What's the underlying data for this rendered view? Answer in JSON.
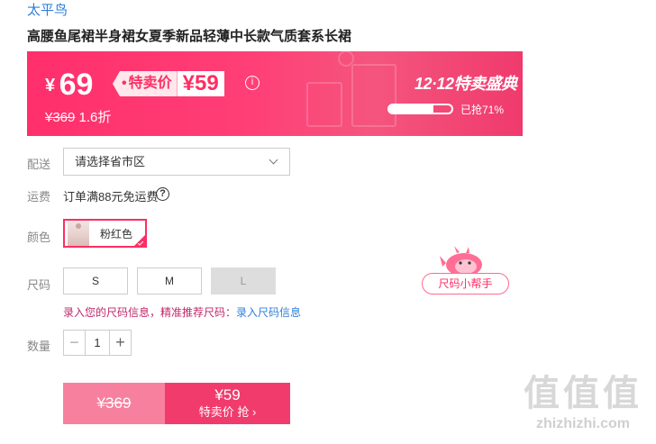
{
  "brand": "太平鸟",
  "title": "高腰鱼尾裙半身裙女夏季新品轻薄中长款气质套系长裙",
  "promo": {
    "currency": "¥",
    "price": "69",
    "tag_label": "特卖价",
    "tag_price": "¥59",
    "original_price": "¥369",
    "discount": "1.6折",
    "event": "12·12特卖盛典",
    "sold_progress": 0.71,
    "sold_text": "已抢71%",
    "icon": "info-icon"
  },
  "delivery": {
    "label": "配送",
    "placeholder": "请选择省市区"
  },
  "shipping": {
    "label": "运费",
    "text": "订单满88元免运费",
    "icon": "help-icon"
  },
  "color": {
    "label": "颜色",
    "option": "粉红色",
    "selected": true
  },
  "size": {
    "label": "尺码",
    "options": [
      {
        "label": "S",
        "available": true
      },
      {
        "label": "M",
        "available": true
      },
      {
        "label": "L",
        "available": false
      }
    ],
    "tip": "录入您的尺码信息，精准推荐尺码：",
    "tip_link": "录入尺码信息",
    "helper": "尺码小帮手"
  },
  "quantity": {
    "label": "数量",
    "value": "1"
  },
  "buy": {
    "original": "¥369",
    "sale_price": "¥59",
    "sale_action": "特卖价 抢 ›"
  },
  "watermark": {
    "big": "值值值",
    "small": "zhizhizhi.com"
  },
  "colors": {
    "accent": "#ff2d63",
    "link": "#2f7fd8",
    "sale_btn": "#f23b6d",
    "orig_btn": "#f7809e"
  }
}
